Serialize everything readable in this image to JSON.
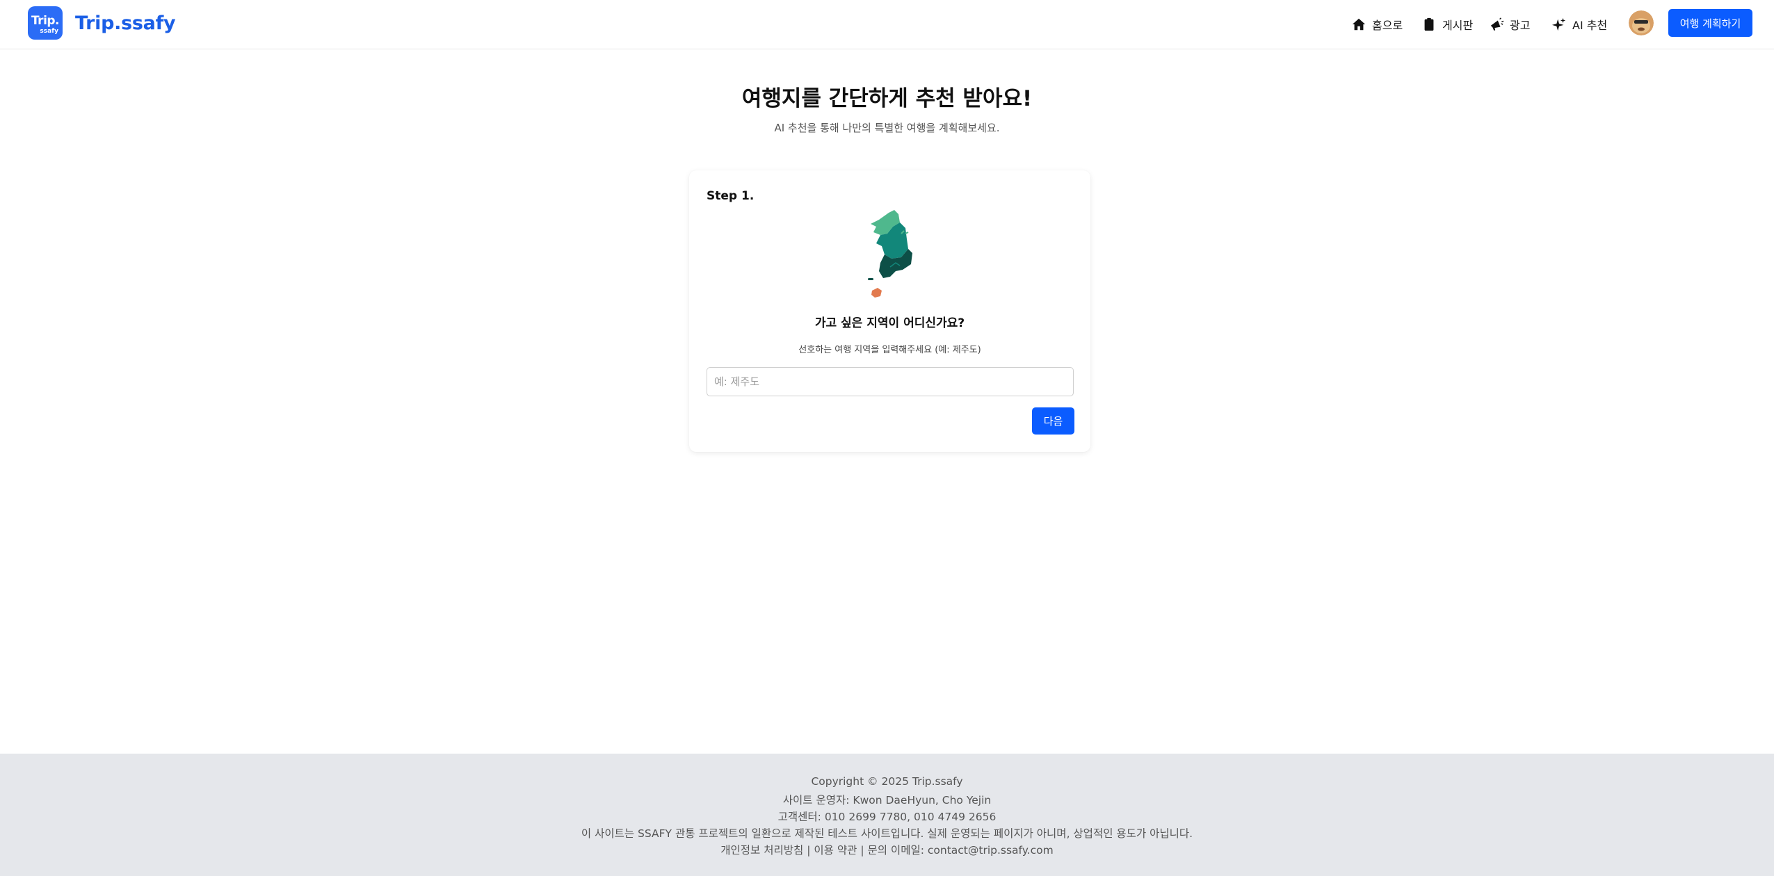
{
  "header": {
    "logo_line1": "Trip.",
    "logo_line2": "ssafy",
    "brand": "Trip.ssafy",
    "nav": [
      {
        "label": "홈으로",
        "icon": "home-icon"
      },
      {
        "label": "게시판",
        "icon": "clipboard-icon"
      },
      {
        "label": "광고",
        "icon": "megaphone-icon"
      },
      {
        "label": "AI 추천",
        "icon": "sparkles-icon"
      }
    ],
    "plan_button": "여행 계획하기"
  },
  "main": {
    "title": "여행지를 간단하게 추천 받아요!",
    "subtitle": "AI 추천을 통해 나만의 특별한 여행을 계획해보세요."
  },
  "card": {
    "step": "Step 1.",
    "question": "가고 싶은 지역이 어디신가요?",
    "hint": "선호하는 여행 지역을 입력해주세요 (예: 제주도)",
    "input_placeholder": "예: 제주도",
    "input_value": "",
    "next_button": "다음"
  },
  "footer": {
    "copyright": "Copyright © 2025 Trip.ssafy",
    "operators": "사이트 운영자: Kwon DaeHyun, Cho Yejin",
    "support": "고객센터: 010 2699 7780, 010 4749 2656",
    "notice": "이 사이트는 SSAFY 관통 프로젝트의 일환으로 제작된 테스트 사이트입니다. 실제 운영되는 페이지가 아니며, 상업적인 용도가 아닙니다.",
    "privacy": "개인정보 처리방침",
    "terms": "이용 약관",
    "contact": "문의 이메일: contact@trip.ssafy.com",
    "separator": "|"
  },
  "colors": {
    "brand_blue": "#1b5fe6",
    "button_blue": "#0b5cff",
    "footer_bg": "#e5e7eb",
    "map_light": "#4fb88d",
    "map_mid": "#12877a",
    "map_dark": "#0d4f47",
    "jeju": "#e27a4e"
  }
}
